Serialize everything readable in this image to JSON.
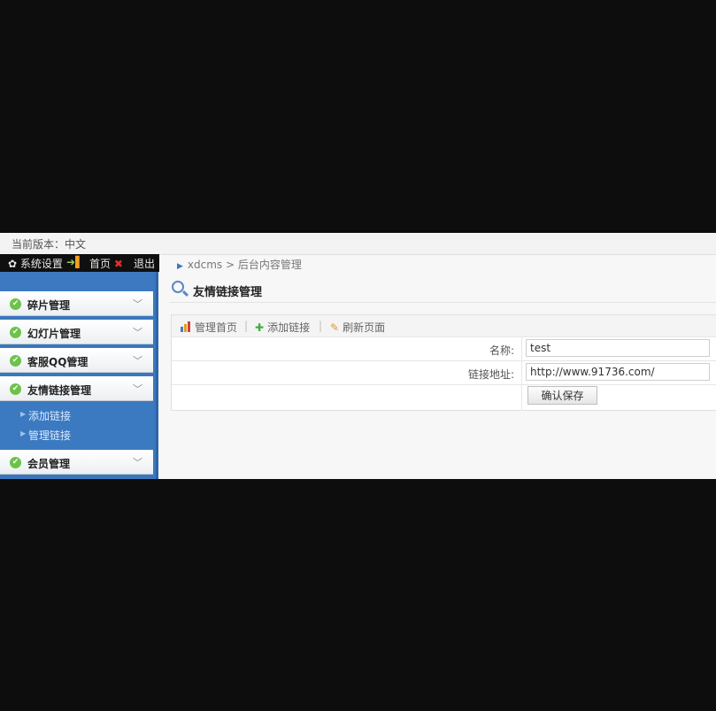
{
  "version_bar": {
    "text": "当前版本：中文"
  },
  "top_toolbar": {
    "settings_label": "系统设置",
    "home_label": "首页",
    "logout_label": "退出"
  },
  "sidebar": {
    "menus": [
      {
        "label": "碎片管理"
      },
      {
        "label": "幻灯片管理"
      },
      {
        "label": "客服QQ管理"
      },
      {
        "label": "友情链接管理"
      },
      {
        "label": "会员管理"
      }
    ],
    "submenu": [
      {
        "label": "添加链接"
      },
      {
        "label": "管理链接"
      }
    ]
  },
  "main": {
    "breadcrumb": "xdcms > 后台内容管理",
    "title": "友情链接管理",
    "toolbar": {
      "manage_home": "管理首页",
      "add_link": "添加链接",
      "refresh": "刷新页面"
    },
    "form": {
      "name_label": "名称:",
      "name_value": "test",
      "url_label": "链接地址:",
      "url_value": "http://www.91736.com/",
      "save_button": "确认保存"
    }
  },
  "colors": {
    "sidebar_blue": "#3a77bd",
    "check_green": "#6cc24a",
    "toolbar_dark": "#0f0f0f"
  }
}
